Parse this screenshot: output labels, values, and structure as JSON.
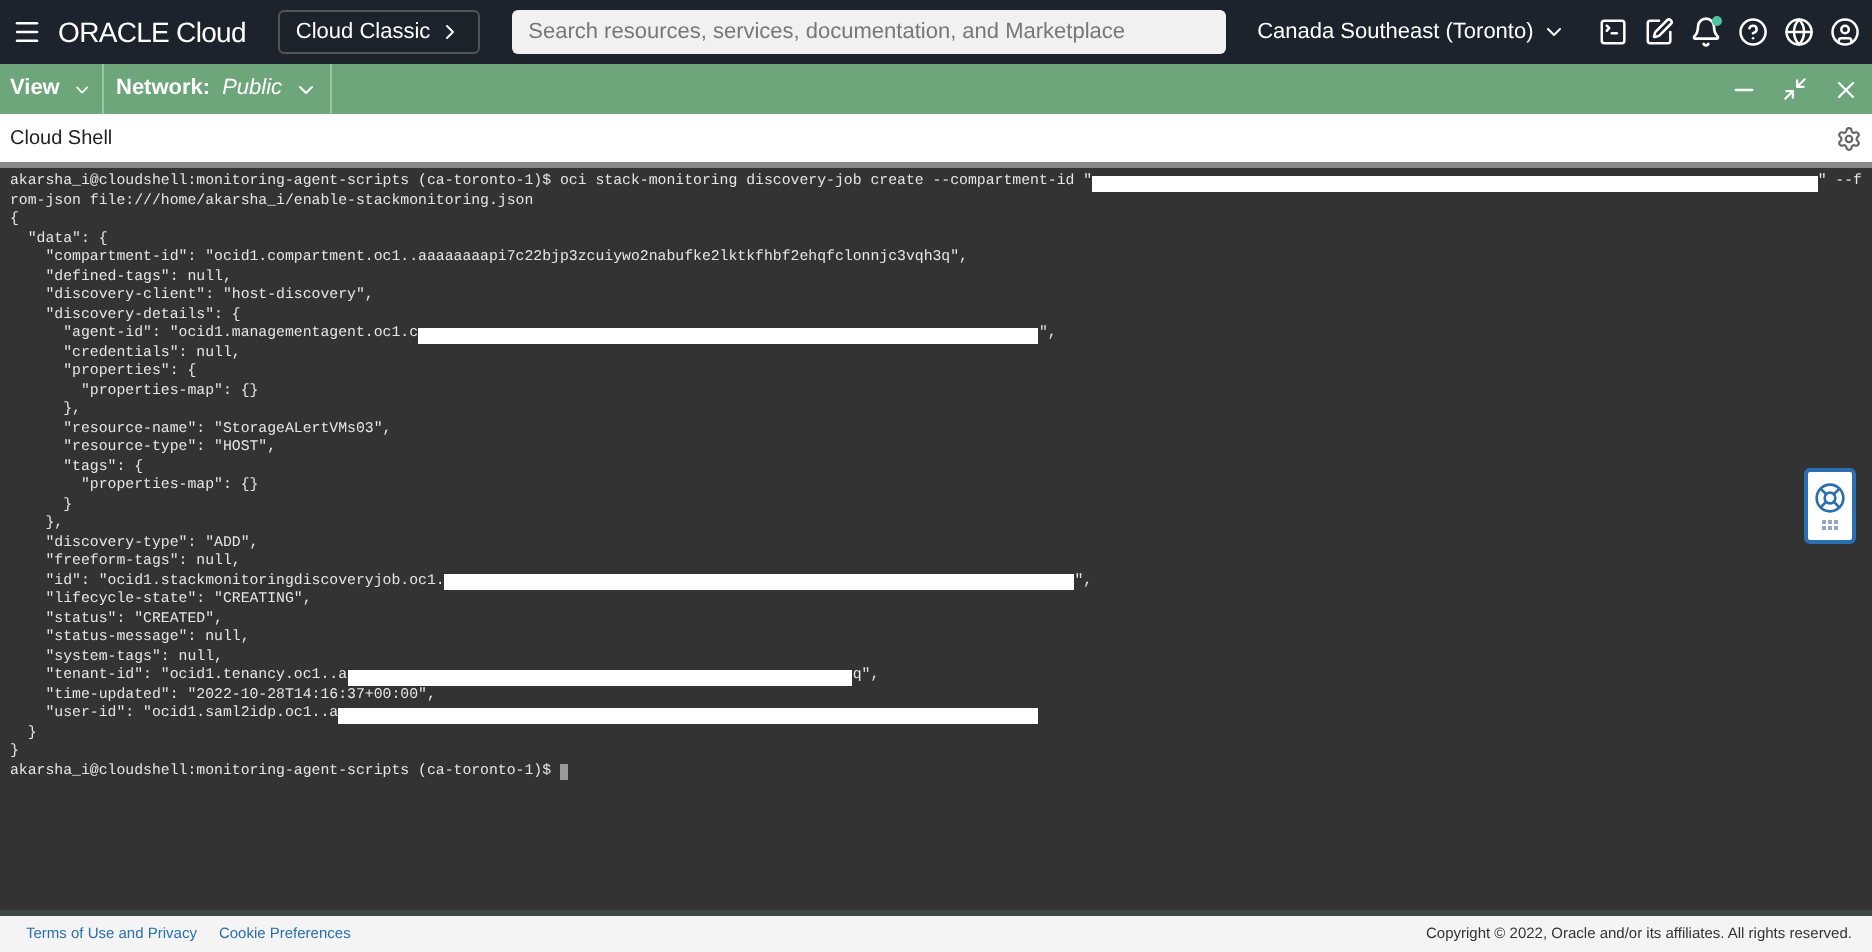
{
  "header": {
    "logo": "ORACLE Cloud",
    "classic_button": "Cloud Classic",
    "search": {
      "placeholder": "Search resources, services, documentation, and Marketplace"
    },
    "region": "Canada Southeast (Toronto)",
    "notification_dot": true
  },
  "toolbar": {
    "view": "View",
    "network_label": "Network:",
    "network_value": "Public"
  },
  "panel": {
    "title": "Cloud Shell"
  },
  "terminal": {
    "lines": [
      [
        {
          "kind": "text",
          "text": "akarsha_i@cloudshell:monitoring-agent-scripts (ca-toronto-1)$ oci stack-monitoring discovery-job create --compartment-id \""
        },
        {
          "kind": "redaction"
        },
        {
          "kind": "text",
          "text": "\" --f"
        }
      ],
      [
        {
          "kind": "text",
          "text": "rom-json file:///home/akarsha_i/enable-stackmonitoring.json"
        }
      ],
      [
        {
          "kind": "text",
          "text": "{"
        }
      ],
      [
        {
          "kind": "text",
          "text": "  \"data\": {"
        }
      ],
      [
        {
          "kind": "text",
          "text": "    \"compartment-id\": \"ocid1.compartment.oc1..aaaaaaaapi7c22bjp3zcuiywo2nabufke2lktkfhbf2ehqfclonnjc3vqh3q\","
        }
      ],
      [
        {
          "kind": "text",
          "text": "    \"defined-tags\": null,"
        }
      ],
      [
        {
          "kind": "text",
          "text": "    \"discovery-client\": \"host-discovery\","
        }
      ],
      [
        {
          "kind": "text",
          "text": "    \"discovery-details\": {"
        }
      ],
      [
        {
          "kind": "text",
          "text": "      \"agent-id\": \"ocid1.managementagent.oc1.c"
        },
        {
          "kind": "redaction"
        },
        {
          "kind": "text",
          "text": "\","
        }
      ],
      [
        {
          "kind": "text",
          "text": "      \"credentials\": null,"
        }
      ],
      [
        {
          "kind": "text",
          "text": "      \"properties\": {"
        }
      ],
      [
        {
          "kind": "text",
          "text": "        \"properties-map\": {}"
        }
      ],
      [
        {
          "kind": "text",
          "text": "      },"
        }
      ],
      [
        {
          "kind": "text",
          "text": "      \"resource-name\": \"StorageALertVMs03\","
        }
      ],
      [
        {
          "kind": "text",
          "text": "      \"resource-type\": \"HOST\","
        }
      ],
      [
        {
          "kind": "text",
          "text": "      \"tags\": {"
        }
      ],
      [
        {
          "kind": "text",
          "text": "        \"properties-map\": {}"
        }
      ],
      [
        {
          "kind": "text",
          "text": "      }"
        }
      ],
      [
        {
          "kind": "text",
          "text": "    },"
        }
      ],
      [
        {
          "kind": "text",
          "text": "    \"discovery-type\": \"ADD\","
        }
      ],
      [
        {
          "kind": "text",
          "text": "    \"freeform-tags\": null,"
        }
      ],
      [
        {
          "kind": "text",
          "text": "    \"id\": \"ocid1.stackmonitoringdiscoveryjob.oc1."
        },
        {
          "kind": "redaction"
        },
        {
          "kind": "text",
          "text": "\","
        }
      ],
      [
        {
          "kind": "text",
          "text": "    \"lifecycle-state\": \"CREATING\","
        }
      ],
      [
        {
          "kind": "text",
          "text": "    \"status\": \"CREATED\","
        }
      ],
      [
        {
          "kind": "text",
          "text": "    \"status-message\": null,"
        }
      ],
      [
        {
          "kind": "text",
          "text": "    \"system-tags\": null,"
        }
      ],
      [
        {
          "kind": "text",
          "text": "    \"tenant-id\": \"ocid1.tenancy.oc1..a"
        },
        {
          "kind": "redaction"
        },
        {
          "kind": "text",
          "text": "q\","
        }
      ],
      [
        {
          "kind": "text",
          "text": "    \"time-updated\": \"2022-10-28T14:16:37+00:00\","
        }
      ],
      [
        {
          "kind": "text",
          "text": "    \"user-id\": \"ocid1.saml2idp.oc1..a"
        },
        {
          "kind": "redaction"
        }
      ],
      [
        {
          "kind": "text",
          "text": "  }"
        }
      ],
      [
        {
          "kind": "text",
          "text": "}"
        }
      ],
      [
        {
          "kind": "text",
          "text": "akarsha_i@cloudshell:monitoring-agent-scripts (ca-toronto-1)$ "
        },
        {
          "kind": "cursor"
        }
      ]
    ]
  },
  "footer": {
    "links": [
      "Terms of Use and Privacy",
      "Cookie Preferences"
    ],
    "copyright": "Copyright © 2022, Oracle and/or its affiliates. All rights reserved."
  }
}
